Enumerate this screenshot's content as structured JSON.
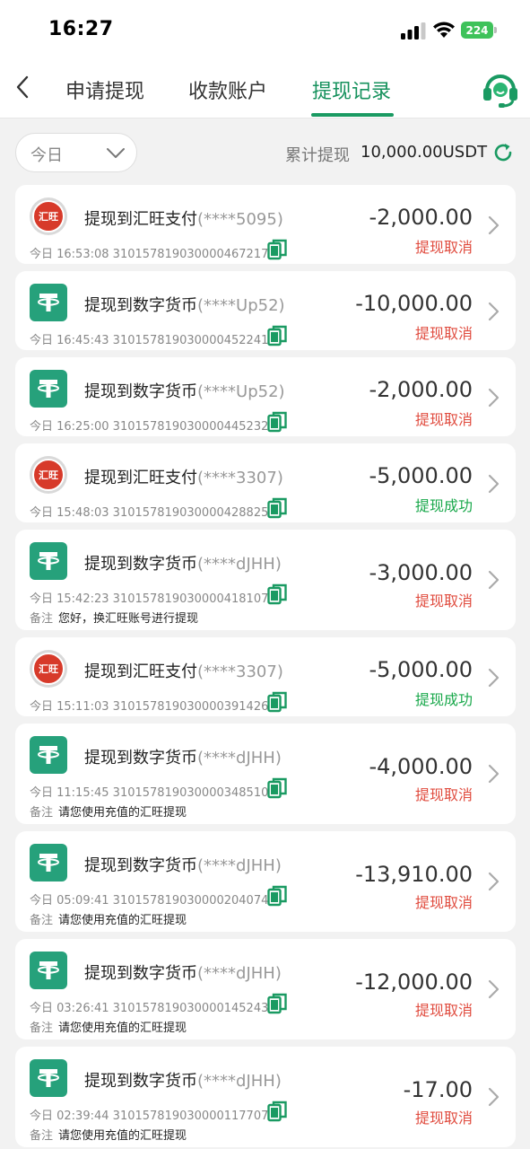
{
  "status_bar": {
    "time": "16:27",
    "battery": "224"
  },
  "nav": {
    "tabs": [
      {
        "label": "申请提现"
      },
      {
        "label": "收款账户"
      },
      {
        "label": "提现记录"
      }
    ],
    "active_tab": "提现记录",
    "accent_color": "#1a9a62"
  },
  "filter": {
    "date_value": "今日",
    "total_label": "累计提现",
    "total_value": "10,000.00USDT"
  },
  "colors": {
    "cancel": "#e04b3e",
    "success": "#19a84b",
    "usdt": "#26a17b",
    "huiwang": "#d73a2a"
  },
  "records": [
    {
      "icon": "huiwang-logo-icon",
      "logo_text": "汇旺",
      "title": "提现到汇旺支付",
      "account": "(****5095)",
      "time": "今日 16:53:08",
      "order": "3101578190300004672​17",
      "amount": "-2,000.00",
      "status": "提现取消",
      "status_type": "cancel",
      "note_label": "",
      "note": ""
    },
    {
      "icon": "usdt-logo-icon",
      "logo_text": "",
      "title": "提现到数字货币",
      "account": "(****Up52)",
      "time": "今日 16:45:43",
      "order": "310157819030000452241",
      "amount": "-10,000.00",
      "status": "提现取消",
      "status_type": "cancel",
      "note_label": "",
      "note": ""
    },
    {
      "icon": "usdt-logo-icon",
      "logo_text": "",
      "title": "提现到数字货币",
      "account": "(****Up52)",
      "time": "今日 16:25:00",
      "order": "310157819030000445232",
      "amount": "-2,000.00",
      "status": "提现取消",
      "status_type": "cancel",
      "note_label": "",
      "note": ""
    },
    {
      "icon": "huiwang-logo-icon",
      "logo_text": "汇旺",
      "title": "提现到汇旺支付",
      "account": "(****3307)",
      "time": "今日 15:48:03",
      "order": "310157819030000428825",
      "amount": "-5,000.00",
      "status": "提现成功",
      "status_type": "success",
      "note_label": "",
      "note": ""
    },
    {
      "icon": "usdt-logo-icon",
      "logo_text": "",
      "title": "提现到数字货币",
      "account": "(****dJHH)",
      "time": "今日 15:42:23",
      "order": "310157819030000418107",
      "amount": "-3,000.00",
      "status": "提现取消",
      "status_type": "cancel",
      "note_label": "备注",
      "note": "您好，换汇旺账号进行提现"
    },
    {
      "icon": "huiwang-logo-icon",
      "logo_text": "汇旺",
      "title": "提现到汇旺支付",
      "account": "(****3307)",
      "time": "今日 15:11:03",
      "order": "310157819030000391426",
      "amount": "-5,000.00",
      "status": "提现成功",
      "status_type": "success",
      "note_label": "",
      "note": ""
    },
    {
      "icon": "usdt-logo-icon",
      "logo_text": "",
      "title": "提现到数字货币",
      "account": "(****dJHH)",
      "time": "今日 11:15:45",
      "order": "310157819030000348510",
      "amount": "-4,000.00",
      "status": "提现取消",
      "status_type": "cancel",
      "note_label": "备注",
      "note": "请您使用充值的汇旺提现"
    },
    {
      "icon": "usdt-logo-icon",
      "logo_text": "",
      "title": "提现到数字货币",
      "account": "(****dJHH)",
      "time": "今日 05:09:41",
      "order": "310157819030000204074",
      "amount": "-13,910.00",
      "status": "提现取消",
      "status_type": "cancel",
      "note_label": "备注",
      "note": "请您使用充值的汇旺提现"
    },
    {
      "icon": "usdt-logo-icon",
      "logo_text": "",
      "title": "提现到数字货币",
      "account": "(****dJHH)",
      "time": "今日 03:26:41",
      "order": "310157819030000145243",
      "amount": "-12,000.00",
      "status": "提现取消",
      "status_type": "cancel",
      "note_label": "备注",
      "note": "请您使用充值的汇旺提现"
    },
    {
      "icon": "usdt-logo-icon",
      "logo_text": "",
      "title": "提现到数字货币",
      "account": "(****dJHH)",
      "time": "今日 02:39:44",
      "order": "310157819030000117707",
      "amount": "-17.00",
      "status": "提现取消",
      "status_type": "cancel",
      "note_label": "备注",
      "note": "请您使用充值的汇旺提现"
    }
  ]
}
